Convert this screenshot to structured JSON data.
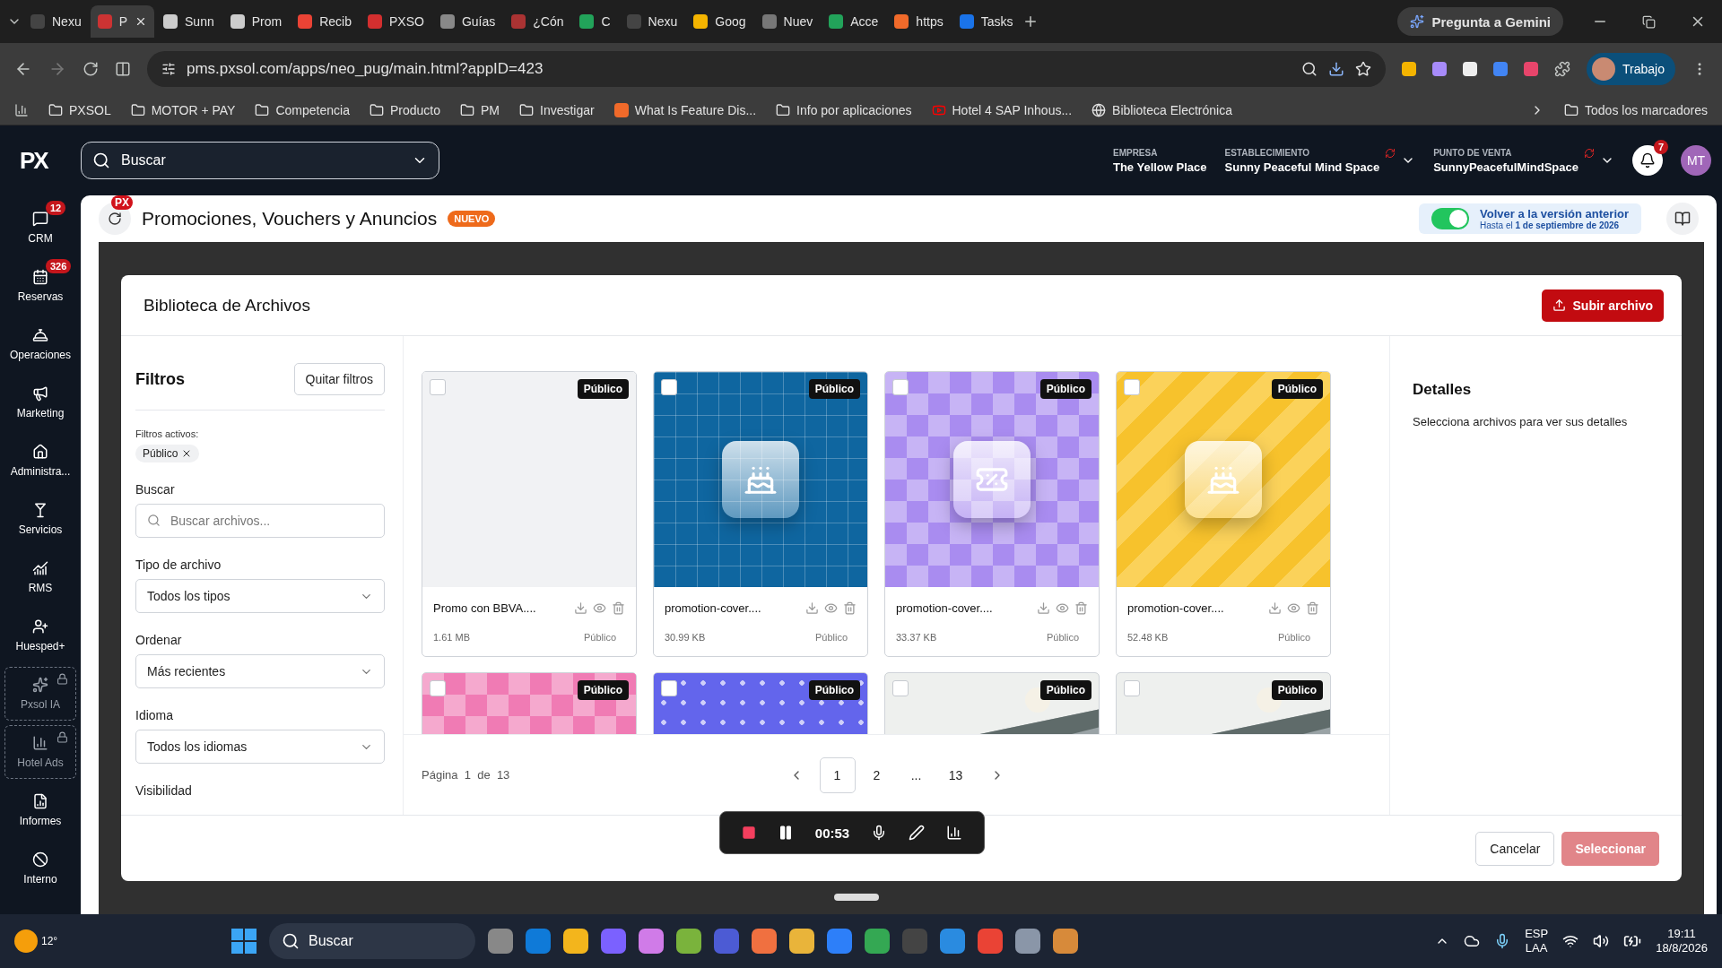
{
  "browser": {
    "tabs": [
      {
        "title": "Nexu",
        "selected": false
      },
      {
        "title": "P",
        "selected": true
      },
      {
        "title": "Sunn",
        "selected": false
      },
      {
        "title": "Prom",
        "selected": false
      },
      {
        "title": "Recib",
        "selected": false
      },
      {
        "title": "PXSO",
        "selected": false
      },
      {
        "title": "Guías",
        "selected": false
      },
      {
        "title": "¿Cón",
        "selected": false
      },
      {
        "title": "C",
        "selected": false
      },
      {
        "title": "Nexu",
        "selected": false
      },
      {
        "title": "Goog",
        "selected": false
      },
      {
        "title": "Nuev",
        "selected": false
      },
      {
        "title": "Acce",
        "selected": false
      },
      {
        "title": "https",
        "selected": false
      },
      {
        "title": "Tasks",
        "selected": false
      }
    ],
    "gemini": "Pregunta a Gemini",
    "address": "pms.pxsol.com/apps/neo_pug/main.html?appID=423",
    "profile": "Trabajo",
    "bookmarks": [
      {
        "label": "PXSOL",
        "kind": "folder"
      },
      {
        "label": "MOTOR + PAY",
        "kind": "folder"
      },
      {
        "label": "Competencia",
        "kind": "folder"
      },
      {
        "label": "Producto",
        "kind": "folder"
      },
      {
        "label": "PM",
        "kind": "folder"
      },
      {
        "label": "Investigar",
        "kind": "folder"
      },
      {
        "label": "What Is Feature Dis...",
        "kind": "site"
      },
      {
        "label": "Info por aplicaciones",
        "kind": "folder"
      },
      {
        "label": "Hotel 4 SAP Inhous...",
        "kind": "video"
      },
      {
        "label": "Biblioteca Electrónica",
        "kind": "globe"
      }
    ],
    "all_bookmarks": "Todos los marcadores"
  },
  "topbar": {
    "logo": "PX",
    "search": "Buscar",
    "contexts": [
      {
        "label": "EMPRESA",
        "value": "The Yellow Place",
        "switchable": false
      },
      {
        "label": "ESTABLECIMIENTO",
        "value": "Sunny Peaceful Mind Space",
        "switchable": true
      },
      {
        "label": "PUNTO DE VENTA",
        "value": "SunnyPeacefulMindSpace",
        "switchable": true
      }
    ],
    "notifications": "7",
    "avatar": "MT"
  },
  "sidebar": {
    "items": [
      {
        "label": "CRM",
        "badge": "12",
        "locked": false
      },
      {
        "label": "Reservas",
        "badge": "326",
        "locked": false
      },
      {
        "label": "Operaciones",
        "locked": false
      },
      {
        "label": "Marketing",
        "locked": false
      },
      {
        "label": "Administra...",
        "locked": false
      },
      {
        "label": "Servicios",
        "locked": false
      },
      {
        "label": "RMS",
        "locked": false
      },
      {
        "label": "Huesped+",
        "locked": false
      },
      {
        "label": "Pxsol IA",
        "locked": true
      },
      {
        "label": "Hotel Ads",
        "locked": true
      },
      {
        "label": "Informes",
        "locked": false
      },
      {
        "label": "Interno",
        "locked": false
      }
    ]
  },
  "page_header": {
    "badge": "PX",
    "title": "Promociones, Vouchers y Anuncios",
    "tag": "NUEVO",
    "legacy": {
      "on": true,
      "title": "Volver a la versión anterior",
      "note": "Hasta el **1 de septiembre de 2026**"
    }
  },
  "modal": {
    "title": "Biblioteca de Archivos",
    "upload": "Subir archivo",
    "filters": {
      "title": "Filtros",
      "clear": "Quitar filtros",
      "active_label": "Filtros activos:",
      "active": [
        "Público"
      ],
      "search_label": "Buscar",
      "search_placeholder": "Buscar archivos...",
      "selects": [
        {
          "label": "Tipo de archivo",
          "value": "Todos los tipos"
        },
        {
          "label": "Ordenar",
          "value": "Más recientes"
        },
        {
          "label": "Idioma",
          "value": "Todos los idiomas"
        }
      ],
      "visibility_label": "Visibilidad"
    },
    "files": [
      {
        "badge": "Público",
        "checked": false,
        "cover": {
          "kind": "blank",
          "color": "#f1f2f4"
        },
        "name": "Promo con BBVA....",
        "size": "1.61 MB",
        "visibility": "Público"
      },
      {
        "badge": "Público",
        "checked": false,
        "cover": {
          "kind": "grid",
          "color": "#0f66a0",
          "emblem": {
            "kind": "cake"
          }
        },
        "name": "promotion-cover....",
        "size": "30.99 KB",
        "visibility": "Público"
      },
      {
        "badge": "Público",
        "checked": false,
        "cover": {
          "kind": "checker",
          "color": "#a98cf0",
          "emblem": {
            "kind": "ticket"
          }
        },
        "name": "promotion-cover....",
        "size": "33.37 KB",
        "visibility": "Público"
      },
      {
        "badge": "Público",
        "checked": false,
        "cover": {
          "kind": "stripes",
          "color": "#f7c22c",
          "emblem": {
            "kind": "cake"
          }
        },
        "name": "promotion-cover....",
        "size": "52.48 KB",
        "visibility": "Público"
      },
      {
        "badge": "Público",
        "checked": false,
        "cover": {
          "kind": "checker",
          "color": "#f07bb4"
        }
      },
      {
        "badge": "Público",
        "checked": false,
        "cover": {
          "kind": "dots",
          "color": "#6365ec"
        }
      },
      {
        "badge": "Público",
        "checked": false
      },
      {
        "badge": "Público",
        "checked": false
      }
    ],
    "pagination": {
      "label": "Página",
      "current": "1",
      "of": "de",
      "total": "13",
      "pages": [
        {
          "label": "1",
          "selected": true
        },
        {
          "label": "2",
          "selected": false
        },
        {
          "label": "...",
          "selected": false
        },
        {
          "label": "13",
          "selected": false
        }
      ]
    },
    "details": {
      "title": "Detalles",
      "hint": "Selecciona archivos para ver sus detalles"
    },
    "cancel": "Cancelar",
    "select": "Seleccionar"
  },
  "recorder": {
    "time": "00:53"
  },
  "taskbar": {
    "temperature": "12°",
    "search": "Buscar",
    "language": "ESP",
    "layout": "LAA",
    "time": "19:11",
    "date": "18/8/2026"
  }
}
